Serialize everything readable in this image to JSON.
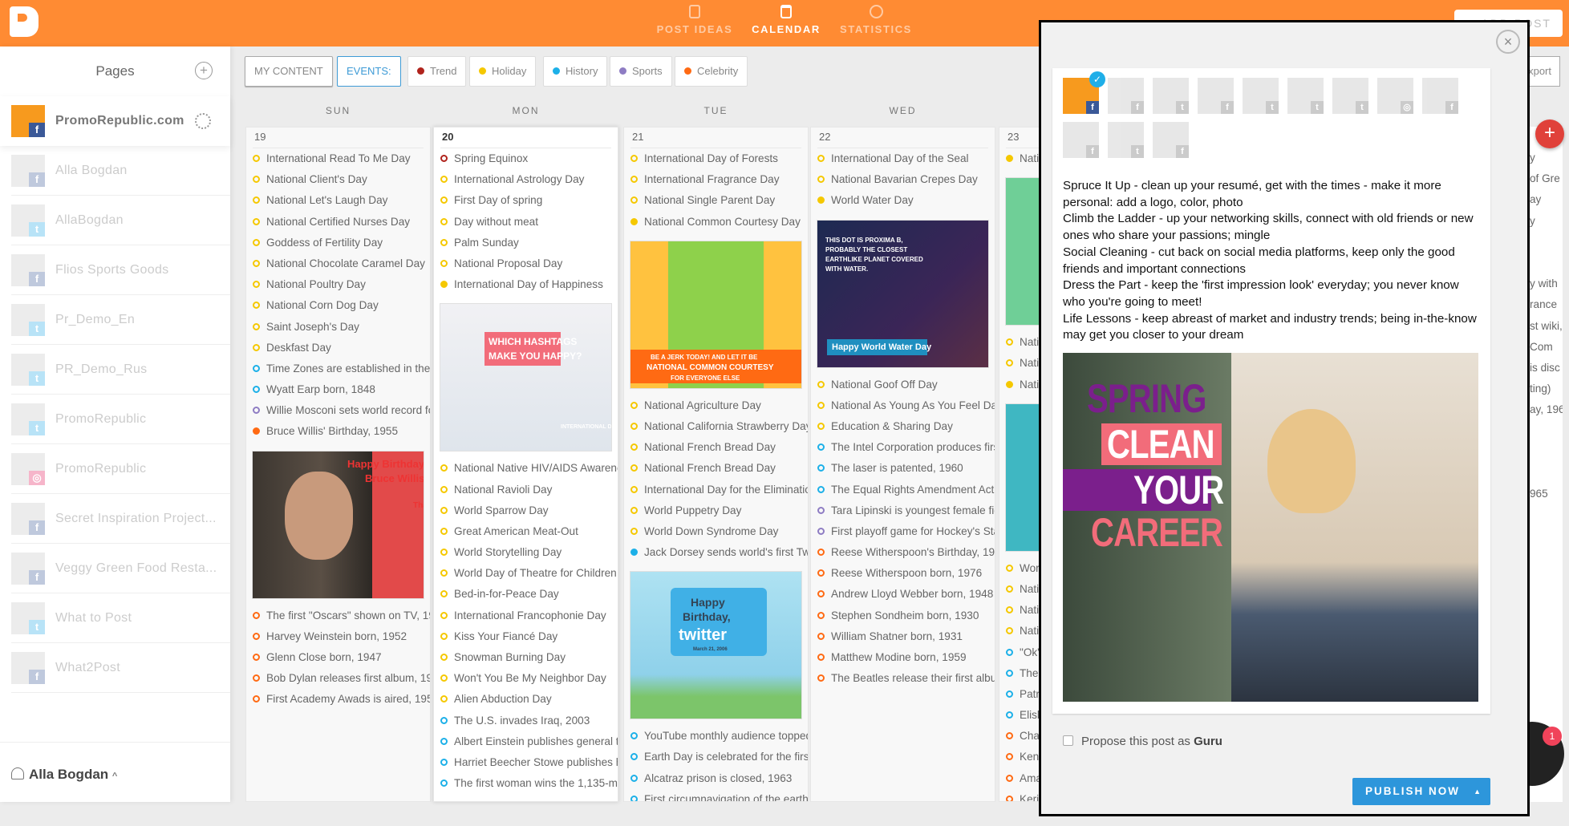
{
  "topbar": {
    "nav": [
      {
        "label": "POST IDEAS",
        "icon": "phone-icon"
      },
      {
        "label": "CALENDAR",
        "icon": "calendar-icon",
        "active": true
      },
      {
        "label": "STATISTICS",
        "icon": "pie-chart-icon"
      }
    ],
    "add_post": "ADD POST"
  },
  "sidebar": {
    "title": "Pages",
    "pages": [
      {
        "name": "PromoRepublic.com",
        "network": "f",
        "selected": true
      },
      {
        "name": "Alla Bogdan",
        "network": "f"
      },
      {
        "name": "AllaBogdan",
        "network": "t"
      },
      {
        "name": "Flios Sports Goods",
        "network": "f"
      },
      {
        "name": "Pr_Demo_En",
        "network": "t"
      },
      {
        "name": "PR_Demo_Rus",
        "network": "t"
      },
      {
        "name": "PromoRepublic",
        "network": "t"
      },
      {
        "name": "PromoRepublic",
        "network": "i"
      },
      {
        "name": "Secret Inspiration Project...",
        "network": "f"
      },
      {
        "name": "Veggy Green Food Resta...",
        "network": "f"
      },
      {
        "name": "What to Post",
        "network": "t"
      },
      {
        "name": "What2Post",
        "network": "f"
      }
    ],
    "user": "Alla Bogdan"
  },
  "filters": {
    "my_content": "MY CONTENT",
    "events": "EVENTS:",
    "categories": [
      {
        "key": "trend",
        "label": "Trend",
        "color": "#B0231C"
      },
      {
        "key": "holiday",
        "label": "Holiday",
        "color": "#F5C800"
      },
      {
        "key": "history",
        "label": "History",
        "color": "#1CB0E8"
      },
      {
        "key": "sports",
        "label": "Sports",
        "color": "#8E7CC3"
      },
      {
        "key": "celebrity",
        "label": "Celebrity",
        "color": "#FF6A13"
      }
    ],
    "export": "Export"
  },
  "days": [
    {
      "weekday": "SUN",
      "date": "19",
      "entries": [
        {
          "c": "holiday",
          "t": "International Read To Me Day"
        },
        {
          "c": "holiday",
          "t": "National Client's Day"
        },
        {
          "c": "holiday",
          "t": "National Let's Laugh Day"
        },
        {
          "c": "holiday",
          "t": "National Certified Nurses Day"
        },
        {
          "c": "holiday",
          "t": "Goddess of Fertility Day"
        },
        {
          "c": "holiday",
          "t": "National Chocolate Caramel Day"
        },
        {
          "c": "holiday",
          "t": "National Poultry Day"
        },
        {
          "c": "holiday",
          "t": "National Corn Dog Day"
        },
        {
          "c": "holiday",
          "t": "Saint Joseph's Day"
        },
        {
          "c": "holiday",
          "t": "Deskfast Day"
        },
        {
          "c": "history",
          "t": "Time Zones are established in the"
        },
        {
          "c": "history",
          "t": "Wyatt Earp born, 1848"
        },
        {
          "c": "sports",
          "t": "Willie Mosconi sets world record fo"
        },
        {
          "c": "celebrity",
          "t": "Bruce Willis' Birthday, 1955",
          "filled": true
        },
        {
          "image": "bruce",
          "texts": [
            "Happy Birthday,",
            "Bruce Willis!",
            "Thank you for saving:"
          ]
        },
        {
          "c": "celebrity",
          "t": "The first \"Oscars\" shown on TV, 19"
        },
        {
          "c": "celebrity",
          "t": "Harvey Weinstein born, 1952"
        },
        {
          "c": "celebrity",
          "t": "Glenn Close born, 1947"
        },
        {
          "c": "celebrity",
          "t": "Bob Dylan releases first album, 196"
        },
        {
          "c": "celebrity",
          "t": "First Academy Awads is aired, 1953"
        }
      ]
    },
    {
      "weekday": "MON",
      "date": "20",
      "today": true,
      "entries": [
        {
          "c": "trend",
          "t": "Spring Equinox"
        },
        {
          "c": "holiday",
          "t": "International Astrology Day"
        },
        {
          "c": "holiday",
          "t": "First Day of spring"
        },
        {
          "c": "holiday",
          "t": "Day without meat"
        },
        {
          "c": "holiday",
          "t": "Palm Sunday"
        },
        {
          "c": "holiday",
          "t": "National Proposal Day"
        },
        {
          "c": "holiday",
          "t": "International Day of Happiness",
          "filled": true
        },
        {
          "image": "hash",
          "texts": [
            "WHICH HASHTAGS",
            "MAKE YOU HAPPY?",
            "INTERNATIONAL DAY OF HAPPINESS"
          ]
        },
        {
          "c": "holiday",
          "t": "National Native HIV/AIDS Awarene"
        },
        {
          "c": "holiday",
          "t": "National Ravioli Day"
        },
        {
          "c": "holiday",
          "t": "World Sparrow Day"
        },
        {
          "c": "holiday",
          "t": "Great American Meat-Out"
        },
        {
          "c": "holiday",
          "t": "World Storytelling Day"
        },
        {
          "c": "holiday",
          "t": "World Day of Theatre for Children"
        },
        {
          "c": "holiday",
          "t": "Bed-in-for-Peace Day"
        },
        {
          "c": "holiday",
          "t": "International Francophonie Day"
        },
        {
          "c": "holiday",
          "t": "Kiss Your Fiancé Day"
        },
        {
          "c": "holiday",
          "t": "Snowman Burning Day"
        },
        {
          "c": "holiday",
          "t": "Won't You Be My Neighbor Day"
        },
        {
          "c": "holiday",
          "t": "Alien Abduction Day"
        },
        {
          "c": "history",
          "t": "The U.S. invades Iraq, 2003"
        },
        {
          "c": "history",
          "t": "Albert Einstein publishes general th"
        },
        {
          "c": "history",
          "t": "Harriet Beecher Stowe publishes he"
        },
        {
          "c": "history",
          "t": "The first woman wins the 1,135-mil"
        }
      ]
    },
    {
      "weekday": "TUE",
      "date": "21",
      "entries": [
        {
          "c": "holiday",
          "t": "International Day of Forests"
        },
        {
          "c": "holiday",
          "t": "International Fragrance Day"
        },
        {
          "c": "holiday",
          "t": "National Single Parent Day"
        },
        {
          "c": "holiday",
          "t": "National Common Courtesy Day",
          "filled": true
        },
        {
          "image": "court",
          "texts": [
            "BE A JERK TODAY! AND LET IT BE",
            "NATIONAL COMMON COURTESY",
            "FOR EVERYONE ELSE"
          ]
        },
        {
          "c": "holiday",
          "t": "National Agriculture Day"
        },
        {
          "c": "holiday",
          "t": "National California Strawberry Day"
        },
        {
          "c": "holiday",
          "t": "National French Bread Day"
        },
        {
          "c": "holiday",
          "t": "National French Bread Day"
        },
        {
          "c": "holiday",
          "t": "International Day for the Eliminatio"
        },
        {
          "c": "holiday",
          "t": "World Puppetry Day"
        },
        {
          "c": "holiday",
          "t": "World Down Syndrome Day"
        },
        {
          "c": "history",
          "t": "Jack Dorsey sends world's first Twe",
          "filled": true
        },
        {
          "image": "tw",
          "texts": [
            "Happy",
            "Birthday,",
            "twitter",
            "March 21, 2006"
          ]
        },
        {
          "c": "history",
          "t": "YouTube monthly audience topped"
        },
        {
          "c": "history",
          "t": "Earth Day is celebrated for the first"
        },
        {
          "c": "history",
          "t": "Alcatraz prison is closed, 1963"
        },
        {
          "c": "history",
          "t": "First circumnavigation of the earth"
        }
      ]
    },
    {
      "weekday": "WED",
      "date": "22",
      "entries": [
        {
          "c": "holiday",
          "t": "International Day of the Seal"
        },
        {
          "c": "holiday",
          "t": "National Bavarian Crepes Day"
        },
        {
          "c": "holiday",
          "t": "World Water Day",
          "filled": true
        },
        {
          "image": "water",
          "texts": [
            "THIS DOT IS PROXIMA B,",
            "PROBABLY THE CLOSEST",
            "EARTHLIKE PLANET COVERED",
            "WITH WATER.",
            "Happy World Water Day"
          ]
        },
        {
          "c": "holiday",
          "t": "National Goof Off Day"
        },
        {
          "c": "holiday",
          "t": "National As Young As You Feel Day"
        },
        {
          "c": "holiday",
          "t": "Education & Sharing Day"
        },
        {
          "c": "history",
          "t": "The Intel Corporation produces first"
        },
        {
          "c": "history",
          "t": "The laser is patented, 1960"
        },
        {
          "c": "history",
          "t": "The Equal Rights Amendment Act p"
        },
        {
          "c": "sports",
          "t": "Tara Lipinski is youngest female figu"
        },
        {
          "c": "sports",
          "t": "First playoff game for Hockey's Stan"
        },
        {
          "c": "celebrity",
          "t": "Reese Witherspoon's Birthday, 197"
        },
        {
          "c": "celebrity",
          "t": "Reese Witherspoon born, 1976"
        },
        {
          "c": "celebrity",
          "t": "Andrew Lloyd Webber born, 1948"
        },
        {
          "c": "celebrity",
          "t": "Stephen Sondheim born, 1930"
        },
        {
          "c": "celebrity",
          "t": "William Shatner born, 1931"
        },
        {
          "c": "celebrity",
          "t": "Matthew Modine born, 1959"
        },
        {
          "c": "celebrity",
          "t": "The Beatles release their first albu"
        }
      ]
    },
    {
      "weekday": "",
      "date": "23",
      "entries": [
        {
          "c": "holiday",
          "t": "Nati",
          "filled": true
        },
        {
          "image": "green",
          "texts": []
        },
        {
          "c": "holiday",
          "t": "Nati"
        },
        {
          "c": "holiday",
          "t": "Nati"
        },
        {
          "c": "holiday",
          "t": "Nati",
          "filled": true
        },
        {
          "image": "teal",
          "texts": []
        },
        {
          "c": "holiday",
          "t": "Wor"
        },
        {
          "c": "holiday",
          "t": "Nati"
        },
        {
          "c": "holiday",
          "t": "Nati"
        },
        {
          "c": "holiday",
          "t": "Nati"
        },
        {
          "c": "history",
          "t": "\"Ok\""
        },
        {
          "c": "history",
          "t": "The"
        },
        {
          "c": "history",
          "t": "Patri"
        },
        {
          "c": "history",
          "t": "Elish"
        },
        {
          "c": "celebrity",
          "t": "Chal"
        },
        {
          "c": "celebrity",
          "t": "Kenn"
        },
        {
          "c": "celebrity",
          "t": "Ama"
        },
        {
          "c": "celebrity",
          "t": "Keri"
        }
      ]
    }
  ],
  "hidden_column_fragments": [
    "y",
    "of Gre",
    "ay",
    "y",
    "",
    "",
    "y with",
    "rance",
    "st wiki,",
    "Com",
    "is disc",
    "ting)",
    "ay, 196",
    "",
    "",
    "",
    "965"
  ],
  "modal": {
    "accounts": [
      {
        "network": "f",
        "selected": true
      },
      {
        "network": "f"
      },
      {
        "network": "t"
      },
      {
        "network": "f"
      },
      {
        "network": "t"
      },
      {
        "network": "t"
      },
      {
        "network": "t"
      },
      {
        "network": "i"
      },
      {
        "network": "f"
      },
      {
        "network": "f"
      },
      {
        "network": "t"
      },
      {
        "network": "f"
      }
    ],
    "text": [
      "Spruce It Up - clean up your resumé, get with the times - make it more personal: add a logo, color, photo",
      "Climb the Ladder - up your networking skills, connect with old friends or new ones who share your passions; mingle",
      "Social Cleaning - cut back on social media platforms, keep only the good friends and important connections",
      "Dress the Part - keep the 'first impression look' everyday; you never know who you're going to meet!",
      "Life Lessons - keep abreast of market and industry trends; being in-the-know may get you closer to your dream"
    ],
    "image_words": [
      "SPRING",
      "CLEAN",
      "YOUR",
      "CAREER"
    ],
    "guru_prefix": "Propose this post as ",
    "guru_bold": "Guru",
    "publish": "PUBLISH NOW"
  },
  "chat_badge": "1",
  "colors": {
    "brand": "#FF8B33",
    "publish": "#2D96DB",
    "add": "#E0413A"
  }
}
